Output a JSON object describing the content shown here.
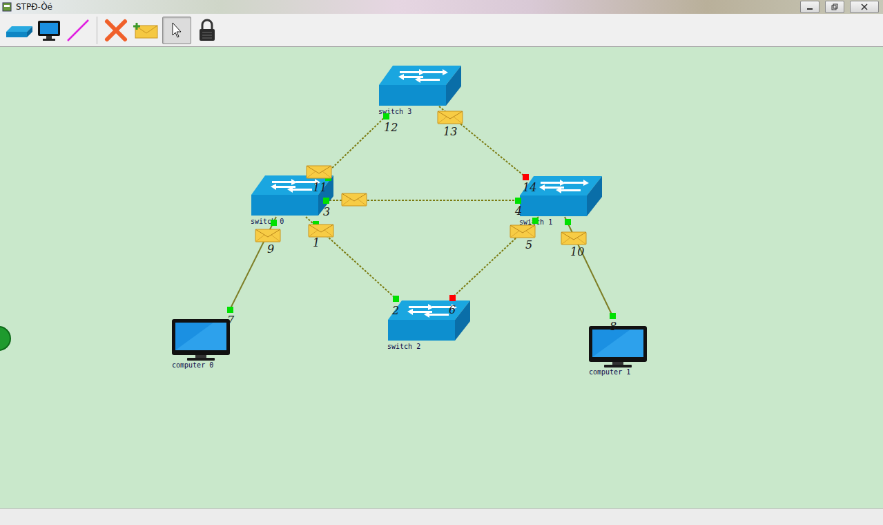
{
  "window": {
    "title": "STPÐ-Òé"
  },
  "toolbar": [
    {
      "kind": "switch",
      "selected": false
    },
    {
      "kind": "computer",
      "selected": false
    },
    {
      "kind": "link",
      "selected": false
    },
    {
      "kind": "delete",
      "selected": false
    },
    {
      "kind": "message",
      "selected": false
    },
    {
      "kind": "select",
      "selected": true
    },
    {
      "kind": "lock",
      "selected": false
    }
  ],
  "nodes": [
    {
      "label": "switch 3",
      "kind": "switch"
    },
    {
      "label": "switch 0",
      "kind": "switch"
    },
    {
      "label": "switch 1",
      "kind": "switch"
    },
    {
      "label": "switch 2",
      "kind": "switch"
    },
    {
      "label": "computer 0",
      "kind": "computer"
    },
    {
      "label": "computer 1",
      "kind": "computer"
    }
  ],
  "ports": [
    {
      "label": "12",
      "color": "#00e000"
    },
    {
      "label": "13",
      "color": "#00e000"
    },
    {
      "label": "14",
      "color": "#ff0000"
    },
    {
      "label": "11",
      "color": "#00e000"
    },
    {
      "label": "3",
      "color": "#00e000"
    },
    {
      "label": "4",
      "color": "#00e000"
    },
    {
      "label": "1",
      "color": "#00e000"
    },
    {
      "label": "2",
      "color": "#00e000"
    },
    {
      "label": "5",
      "color": "#00e000"
    },
    {
      "label": "6",
      "color": "#ff0000"
    },
    {
      "label": "9",
      "color": "#00e000"
    },
    {
      "label": "7",
      "color": "#00e000"
    },
    {
      "label": "10",
      "color": "#00e000"
    },
    {
      "label": "8",
      "color": "#00e000"
    }
  ],
  "links": [
    {
      "ends": [
        "12",
        "11"
      ],
      "kind": "dashed",
      "message": true
    },
    {
      "ends": [
        "13",
        "14"
      ],
      "kind": "dashed",
      "message": true
    },
    {
      "ends": [
        "3",
        "4"
      ],
      "kind": "dashed",
      "message": true
    },
    {
      "ends": [
        "1",
        "2"
      ],
      "kind": "dashed",
      "message": true
    },
    {
      "ends": [
        "5",
        "6"
      ],
      "kind": "dashed",
      "message": true
    },
    {
      "ends": [
        "9",
        "7"
      ],
      "kind": "solid",
      "message": true
    },
    {
      "ends": [
        "10",
        "8"
      ],
      "kind": "solid",
      "message": true
    }
  ]
}
